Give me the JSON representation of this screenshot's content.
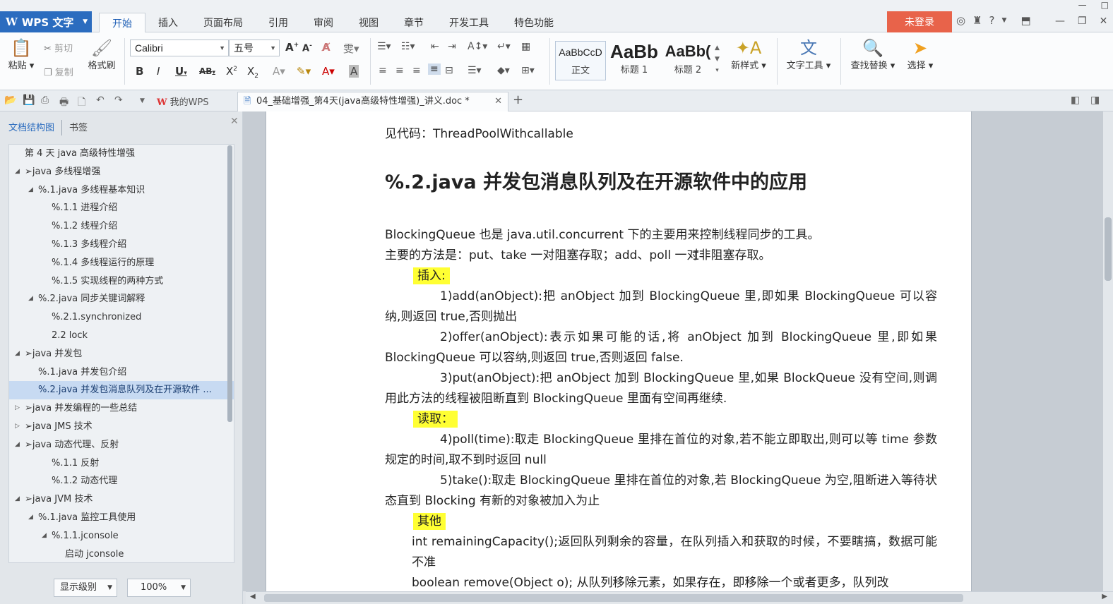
{
  "app": {
    "name": "WPS 文字"
  },
  "menu_tabs": [
    "开始",
    "插入",
    "页面布局",
    "引用",
    "审阅",
    "视图",
    "章节",
    "开发工具",
    "特色功能"
  ],
  "login_label": "未登录",
  "ribbon": {
    "paste": "粘贴",
    "cut": "剪切",
    "copy": "复制",
    "format_painter": "格式刷",
    "font_name": "Calibri",
    "font_size": "五号",
    "styles": [
      {
        "sample": "AaBbCcD",
        "name": "正文"
      },
      {
        "sample": "AaBb",
        "name": "标题 1"
      },
      {
        "sample": "AaBb(",
        "name": "标题 2"
      }
    ],
    "new_style": "新样式",
    "text_tools": "文字工具",
    "find_replace": "查找替换",
    "select": "选择"
  },
  "tabbar": {
    "my_wps": "我的WPS",
    "doc_tab": "04_基础增强_第4天(java高级特性增强)_讲义.doc *"
  },
  "nav": {
    "tab_outline": "文档结构图",
    "tab_bookmarks": "书签",
    "items": [
      {
        "label": "第 4 天 java 高级特性增强",
        "level": 0,
        "toggle": ""
      },
      {
        "label": "➢java 多线程增强",
        "level": 0,
        "toggle": "expanded"
      },
      {
        "label": "%.1.java 多线程基本知识",
        "level": 1,
        "toggle": "expanded"
      },
      {
        "label": "%.1.1 进程介绍",
        "level": 2,
        "toggle": ""
      },
      {
        "label": "%.1.2 线程介绍",
        "level": 2,
        "toggle": ""
      },
      {
        "label": "%.1.3 多线程介绍",
        "level": 2,
        "toggle": ""
      },
      {
        "label": "%.1.4 多线程运行的原理",
        "level": 2,
        "toggle": ""
      },
      {
        "label": "%.1.5 实现线程的两种方式",
        "level": 2,
        "toggle": ""
      },
      {
        "label": "%.2.java 同步关键词解释",
        "level": 1,
        "toggle": "expanded"
      },
      {
        "label": "%.2.1.synchronized",
        "level": 2,
        "toggle": ""
      },
      {
        "label": "2.2 lock",
        "level": 2,
        "toggle": ""
      },
      {
        "label": "➢java 并发包",
        "level": 0,
        "toggle": "expanded"
      },
      {
        "label": "%.1.java 并发包介绍",
        "level": 1,
        "toggle": ""
      },
      {
        "label": "%.2.java 并发包消息队列及在开源软件 ...",
        "level": 1,
        "toggle": "",
        "selected": true
      },
      {
        "label": "➢java 并发编程的一些总结",
        "level": 0,
        "toggle": "collapsed"
      },
      {
        "label": "➢java JMS 技术",
        "level": 0,
        "toggle": "collapsed"
      },
      {
        "label": "➢java 动态代理、反射",
        "level": 0,
        "toggle": "expanded"
      },
      {
        "label": "%.1.1 反射",
        "level": 2,
        "toggle": ""
      },
      {
        "label": "%.1.2 动态代理",
        "level": 2,
        "toggle": ""
      },
      {
        "label": "➢java JVM 技术",
        "level": 0,
        "toggle": "expanded"
      },
      {
        "label": "%.1.java 监控工具使用",
        "level": 1,
        "toggle": "expanded"
      },
      {
        "label": "%.1.1.jconsole",
        "level": 2,
        "toggle": "expanded"
      },
      {
        "label": "启动 jconsole",
        "level": 3,
        "toggle": ""
      }
    ],
    "display_level": "显示级别",
    "zoom": "100%"
  },
  "doc": {
    "code_ref": "见代码：ThreadPoolWithcallable",
    "heading": "%.2.java 并发包消息队列及在开源软件中的应用",
    "p1": "BlockingQueue 也是 java.util.concurrent 下的主要用来控制线程同步的工具。",
    "p2": "主要的方法是：put、take 一对阻塞存取；add、poll 一对非阻塞存取。",
    "insert_label": "插入:",
    "insert_items": [
      "1)add(anObject):把 anObject 加到 BlockingQueue 里,即如果 BlockingQueue 可以容纳,则返回 true,否则抛出",
      "2)offer(anObject):表示如果可能的话,将 anObject 加到 BlockingQueue 里,即如果 BlockingQueue 可以容纳,则返回 true,否则返回 false.",
      "3)put(anObject):把 anObject 加到 BlockingQueue 里,如果 BlockQueue 没有空间,则调用此方法的线程被阻断直到 BlockingQueue 里面有空间再继续."
    ],
    "read_label": "读取：",
    "read_items": [
      "4)poll(time):取走 BlockingQueue 里排在首位的对象,若不能立即取出,则可以等 time 参数规定的时间,取不到时返回 null",
      "5)take():取走 BlockingQueue 里排在首位的对象,若 BlockingQueue 为空,阻断进入等待状态直到 Blocking 有新的对象被加入为止"
    ],
    "other_label": "其他",
    "other_items": [
      "int remainingCapacity();返回队列剩余的容量，在队列插入和获取的时候，不要瞎搞，数据可能不准",
      "boolean remove(Object o); 从队列移除元素，如果存在，即移除一个或者更多，队列改"
    ]
  },
  "colors": {
    "accent": "#2b6cbf",
    "login": "#e8634a",
    "highlight": "#ffff33"
  }
}
